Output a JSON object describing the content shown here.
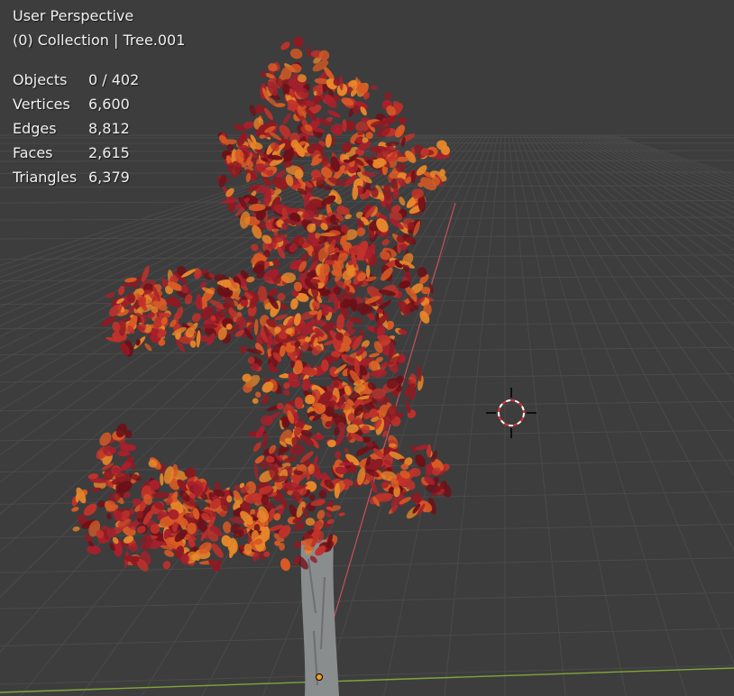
{
  "viewport": {
    "view_name": "User Perspective",
    "collection_line": "(0) Collection | Tree.001",
    "background_color": "#3d3d3d",
    "grid_color": "#4a4a4a",
    "x_axis_color": "#c9505a",
    "y_axis_color": "#7ea63a"
  },
  "stats": [
    {
      "label": "Objects",
      "value": "0 / 402"
    },
    {
      "label": "Vertices",
      "value": "6,600"
    },
    {
      "label": "Edges",
      "value": "8,812"
    },
    {
      "label": "Faces",
      "value": "2,615"
    },
    {
      "label": "Triangles",
      "value": "6,379"
    }
  ],
  "scene": {
    "object": "autumn-tree",
    "leaf_colors": [
      "#8e1a22",
      "#c0322a",
      "#d95a24",
      "#e8872a",
      "#a8202c",
      "#6e1018"
    ],
    "trunk_color": "#8a8d8e",
    "cursor_icon": "3d-cursor-icon",
    "origin_icon": "object-origin-icon"
  }
}
